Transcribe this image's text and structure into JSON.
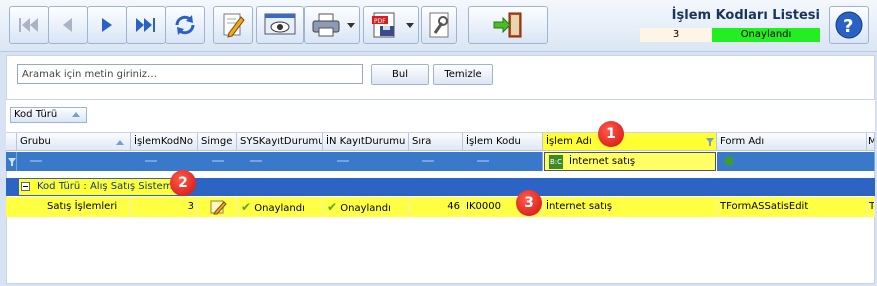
{
  "window": {
    "title": "İşlem Kodları Listesi",
    "record_count": "3",
    "status": "Onaylandı",
    "status_color": "#22ee22"
  },
  "toolbar": {
    "buttons": [
      {
        "name": "first-record-button",
        "icon": "first-icon"
      },
      {
        "name": "previous-record-button",
        "icon": "previous-icon"
      },
      {
        "name": "next-record-button",
        "icon": "next-icon"
      },
      {
        "name": "last-record-button",
        "icon": "last-icon"
      },
      {
        "name": "refresh-button",
        "icon": "refresh-icon"
      },
      {
        "name": "edit-button",
        "icon": "pencil-icon"
      },
      {
        "name": "view-button",
        "icon": "eye-icon"
      },
      {
        "name": "print-button",
        "icon": "printer-icon"
      },
      {
        "name": "export-pdf-button",
        "icon": "pdf-icon"
      },
      {
        "name": "tools-button",
        "icon": "wrench-icon"
      },
      {
        "name": "exit-button",
        "icon": "exit-door-icon"
      },
      {
        "name": "help-button",
        "icon": "help-icon"
      }
    ]
  },
  "search": {
    "placeholder": "Aramak için metin giriniz…",
    "find_label": "Bul",
    "clear_label": "Temizle"
  },
  "group_panel": {
    "group_by_chip": "Kod Türü"
  },
  "grid": {
    "columns": [
      "Grubu",
      "İşlemKodNo",
      "Simge",
      "SYSKayıtDurumu",
      "İN KayıtDurumu",
      "Sıra",
      "İşlem Kodu",
      "İşlem Adı",
      "Form Adı",
      "M"
    ],
    "filter": {
      "islem_adi": "İnternet satış",
      "operator": "B:C"
    },
    "group_row": "Kod Türü : Alış Satış Sistemi",
    "rows": [
      {
        "grubu": "Satış İşlemleri",
        "islem_kod_no": "3",
        "simge": "pencil-icon",
        "sys_kayit_durumu": "Onaylandı",
        "in_kayit_durumu": "Onaylandı",
        "sira": "46",
        "islem_kodu": "IK0000",
        "islem_adi": "İnternet satış",
        "form_adi": "TFormASSatisEdit",
        "m": "T"
      }
    ]
  },
  "callouts": [
    "1",
    "2",
    "3"
  ]
}
